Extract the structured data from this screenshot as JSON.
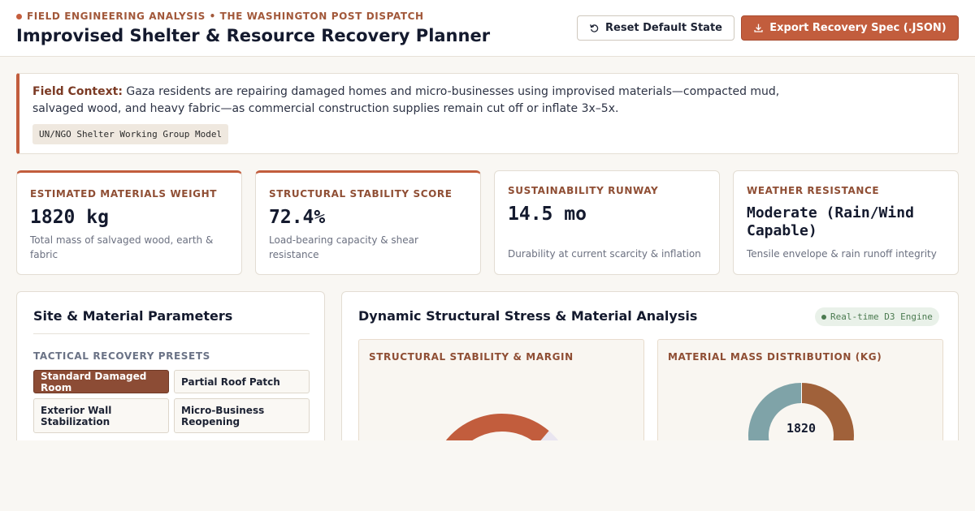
{
  "header": {
    "eyebrow": "FIELD ENGINEERING ANALYSIS • THE WASHINGTON POST DISPATCH",
    "title": "Improvised Shelter & Resource Recovery Planner",
    "reset_label": "Reset Default State",
    "export_label": "Export Recovery Spec (.JSON)"
  },
  "context": {
    "label": "Field Context:",
    "text": "Gaza residents are repairing damaged homes and micro-businesses using improvised materials—compacted mud, salvaged wood, and heavy fabric—as commercial construction supplies remain cut off or inflate 3x–5x.",
    "tag": "UN/NGO Shelter Working Group Model"
  },
  "stats": [
    {
      "label": "ESTIMATED MATERIALS WEIGHT",
      "value": "1820 kg",
      "desc": "Total mass of salvaged wood, earth & fabric"
    },
    {
      "label": "STRUCTURAL STABILITY SCORE",
      "value": "72.4%",
      "desc": "Load-bearing capacity & shear resistance"
    },
    {
      "label": "SUSTAINABILITY RUNWAY",
      "value": "14.5 mo",
      "desc": "Durability at current scarcity & inflation"
    },
    {
      "label": "WEATHER RESISTANCE",
      "value": "Moderate (Rain/Wind Capable)",
      "desc": "Tensile envelope & rain runoff integrity"
    }
  ],
  "parameters": {
    "title": "Site & Material Parameters",
    "presets_label": "TACTICAL RECOVERY PRESETS",
    "presets": [
      {
        "label": "Standard Damaged Room",
        "active": true
      },
      {
        "label": "Partial Roof Patch",
        "active": false
      },
      {
        "label": "Exterior Wall Stabilization",
        "active": false
      },
      {
        "label": "Micro-Business Reopening",
        "active": false
      }
    ]
  },
  "analysis": {
    "title": "Dynamic Structural Stress & Material Analysis",
    "engine_badge": "Real-time D3 Engine",
    "stability_title": "STRUCTURAL STABILITY & MARGIN",
    "mass_title": "MATERIAL MASS DISTRIBUTION (KG)",
    "mass_center": "1820"
  },
  "chart_data": [
    {
      "type": "gauge",
      "title": "STRUCTURAL STABILITY & MARGIN",
      "value": 72.4,
      "range": [
        0,
        100
      ],
      "colors": {
        "fill": "#c25d3d",
        "track": "#e9e5f0"
      }
    },
    {
      "type": "pie",
      "title": "MATERIAL MASS DISTRIBUTION (KG)",
      "total": 1820,
      "slices": [
        {
          "color": "#a0613a",
          "share": 0.5
        },
        {
          "color": "#c25d3d",
          "share": 0.2
        },
        {
          "color": "#7fa3a8",
          "share": 0.3
        }
      ]
    }
  ],
  "colors": {
    "accent": "#c25d3d",
    "accent_dark": "#8c4c35",
    "badge_green": "#4b7a50"
  },
  "icons": {
    "reset": "rotate-ccw-icon",
    "export": "download-icon"
  }
}
